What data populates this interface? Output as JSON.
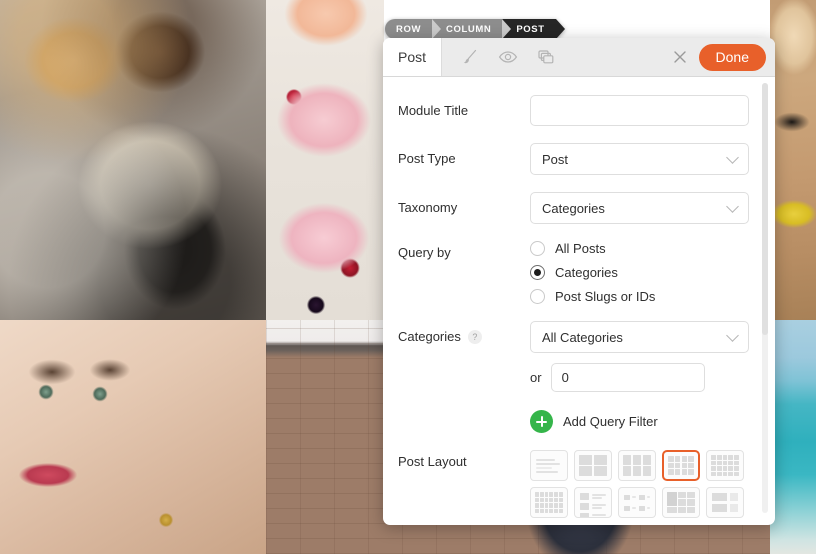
{
  "breadcrumb": {
    "items": [
      {
        "label": "ROW",
        "active": false
      },
      {
        "label": "COLUMN",
        "active": false
      },
      {
        "label": "POST",
        "active": true
      }
    ]
  },
  "panel": {
    "tab_label": "Post",
    "header_icons": [
      {
        "name": "brush-icon",
        "title": "Style"
      },
      {
        "name": "eye-icon",
        "title": "Preview"
      },
      {
        "name": "duplicate-icon",
        "title": "Duplicate"
      }
    ],
    "close_label": "×",
    "done_label": "Done",
    "accent_color": "#e8602a",
    "add_color": "#35b54a"
  },
  "form": {
    "module_title": {
      "label": "Module Title",
      "value": "",
      "placeholder": ""
    },
    "post_type": {
      "label": "Post Type",
      "value": "Post",
      "options": [
        "Post"
      ]
    },
    "taxonomy": {
      "label": "Taxonomy",
      "value": "Categories",
      "options": [
        "Categories"
      ]
    },
    "query_by": {
      "label": "Query by",
      "selected": "Categories",
      "options": [
        {
          "label": "All Posts",
          "checked": false
        },
        {
          "label": "Categories",
          "checked": true
        },
        {
          "label": "Post Slugs or IDs",
          "checked": false
        }
      ]
    },
    "categories": {
      "label": "Categories",
      "help": "?",
      "value": "All Categories",
      "options": [
        "All Categories"
      ],
      "or_label": "or",
      "or_value": "0"
    },
    "add_query_filter": {
      "label": "Add Query Filter",
      "icon": "plus-circle-icon"
    },
    "post_layout": {
      "label": "Post Layout",
      "selected_index": 3,
      "thumbs": [
        {
          "name": "layout-list",
          "kind": "list"
        },
        {
          "name": "layout-grid-2x2",
          "kind": "g2"
        },
        {
          "name": "layout-grid-3x2",
          "kind": "g3"
        },
        {
          "name": "layout-grid-4x3",
          "kind": "g4"
        },
        {
          "name": "layout-grid-5x4",
          "kind": "g5"
        },
        {
          "name": "layout-grid-6x4",
          "kind": "g6"
        },
        {
          "name": "layout-media-list",
          "kind": "media"
        },
        {
          "name": "layout-scatter-grid",
          "kind": "scatter"
        },
        {
          "name": "layout-masonry-mixed",
          "kind": "mix"
        },
        {
          "name": "layout-sidebar-blocks",
          "kind": "side"
        }
      ]
    }
  }
}
